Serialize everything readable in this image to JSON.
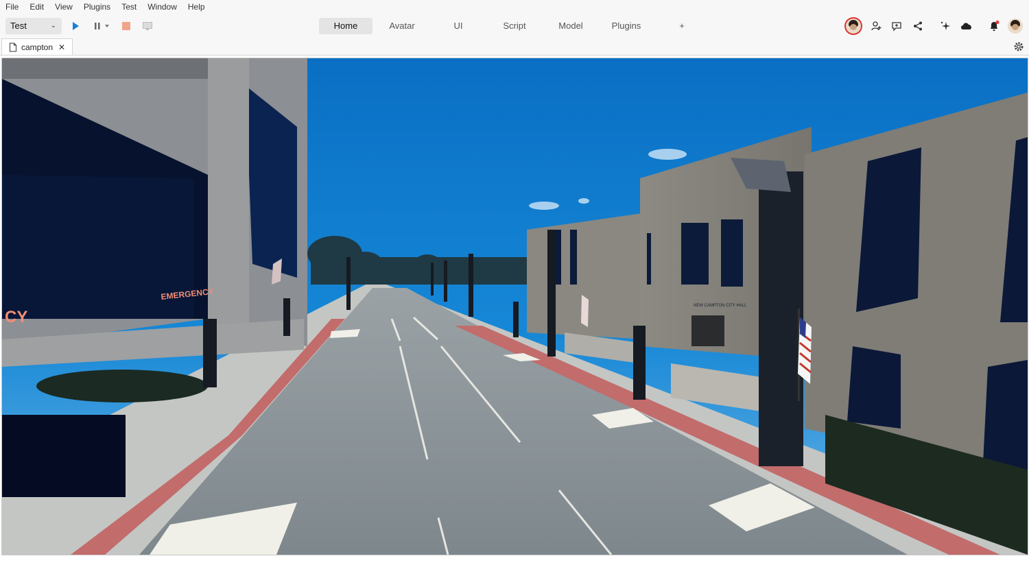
{
  "menu": [
    "File",
    "Edit",
    "View",
    "Plugins",
    "Test",
    "Window",
    "Help"
  ],
  "toolbar": {
    "mode_value": "Test",
    "tabs": [
      "Home",
      "Avatar",
      "UI",
      "Script",
      "Model",
      "Plugins",
      "+"
    ],
    "active_tab": "Home",
    "icons": {
      "play": "play-icon",
      "pause": "pause-icon",
      "stop": "stop-icon",
      "screen": "screen-icon",
      "collab_avatar": "collaborator-avatar",
      "add_user": "add-user-icon",
      "chat": "chat-icon",
      "share": "share-icon",
      "ai": "sparkle-icon",
      "cloud": "cloud-icon",
      "notify": "bell-icon",
      "profile": "profile-avatar"
    }
  },
  "document": {
    "tab_name": "campton"
  },
  "viewport": {
    "signs": {
      "left_building_text": "CY",
      "emergency": "EMERGENCY",
      "city_hall": "NEW CAMPTON CITY HALL"
    }
  },
  "colors": {
    "play": "#1e7ed8",
    "stop": "#f0a58a",
    "sky_top": "#0a6fc4",
    "road": "#8a9398",
    "curb_red": "#c26c6c",
    "notification": "#e04040"
  }
}
